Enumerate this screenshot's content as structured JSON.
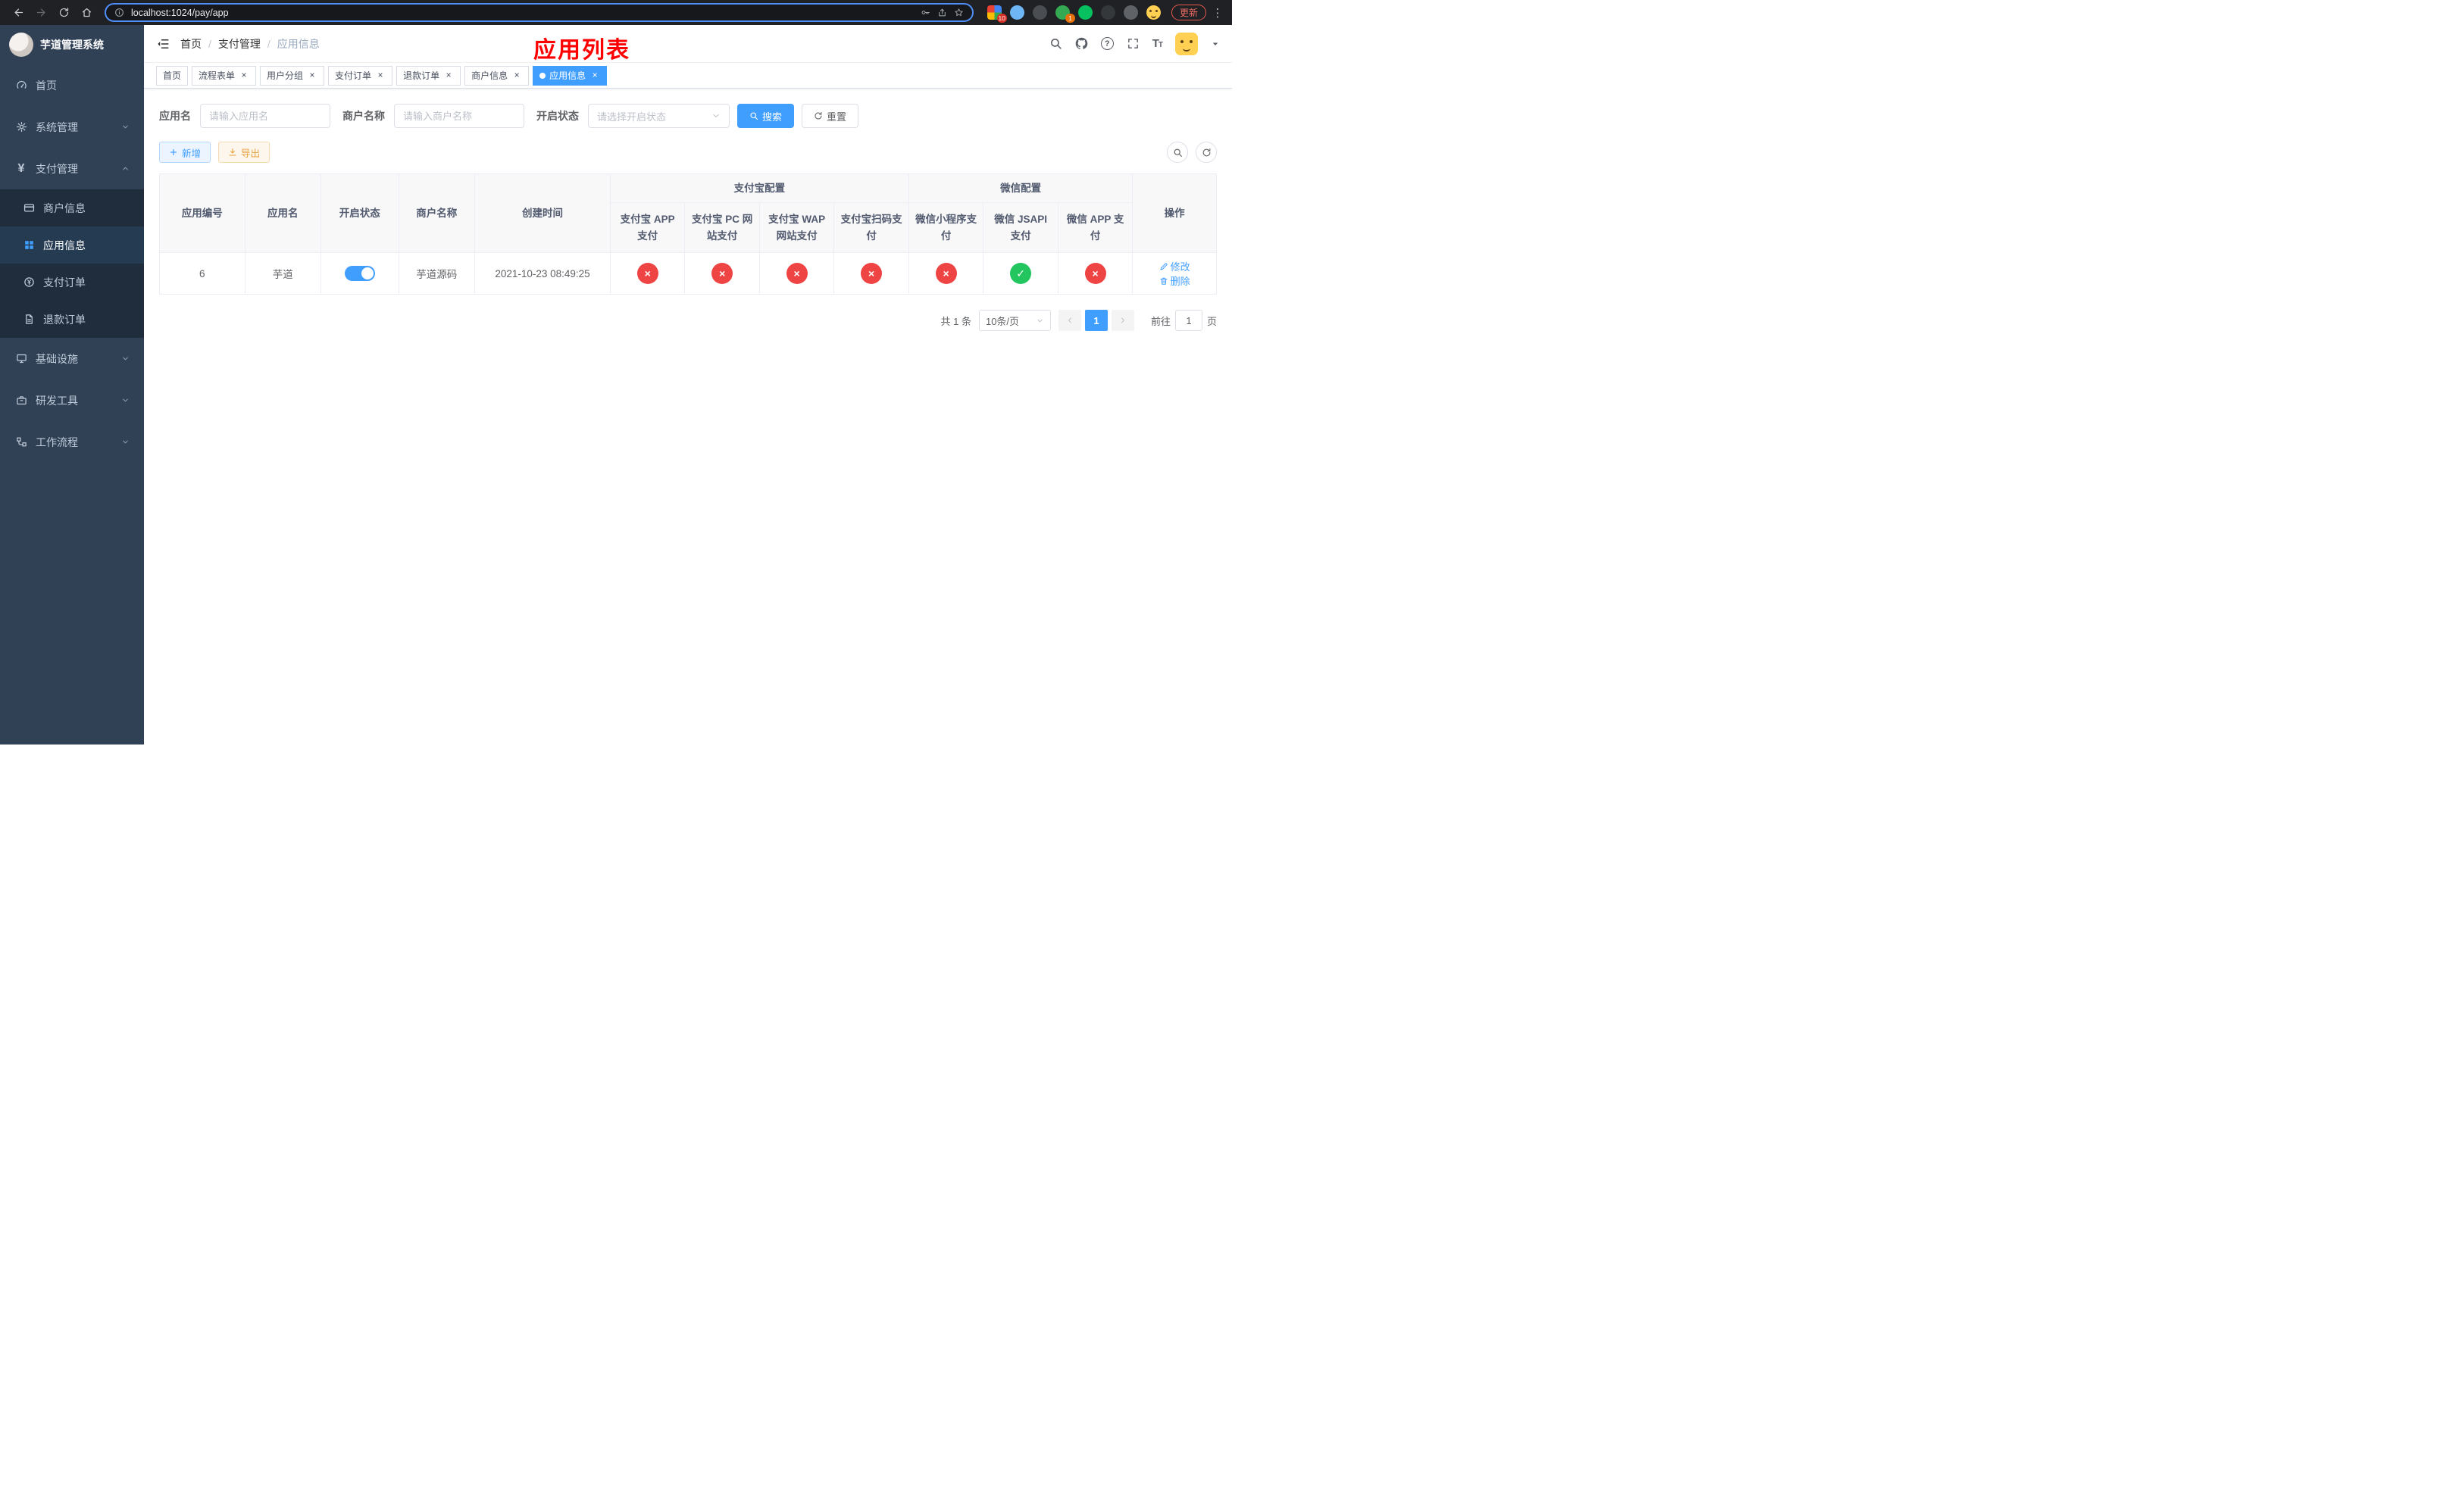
{
  "colors": {
    "accent": "#409eff",
    "success": "#22c55e",
    "danger": "#ef4444",
    "warning": "#e6a23c",
    "sidebar_bg": "#304156",
    "submenu_bg": "#1f2d3d",
    "annotation": "#ff0000"
  },
  "browser": {
    "nav_icons": [
      "back-icon",
      "forward-icon",
      "reload-icon",
      "home-icon"
    ],
    "url": "localhost:1024/pay/app",
    "omnibox_icons": [
      "info-icon",
      "key-icon",
      "share-icon",
      "star-icon"
    ],
    "extensions": [
      {
        "name": "colorful-grid-extension",
        "badge": "10"
      },
      {
        "name": "blue-extension"
      },
      {
        "name": "dark-extension"
      },
      {
        "name": "green-extension",
        "badge": "1"
      },
      {
        "name": "wechat-devtools-extension"
      },
      {
        "name": "dark-extension-2"
      },
      {
        "name": "gray-extension"
      },
      {
        "name": "profile-avatar-face"
      }
    ],
    "update_button": "更新",
    "menu_icon": "kebab-menu-icon"
  },
  "sidebar": {
    "logo_title": "芋道管理系统",
    "menu": [
      {
        "label": "首页",
        "icon": "dashboard-icon"
      },
      {
        "label": "系统管理",
        "icon": "gear-icon",
        "state": "collapsed"
      },
      {
        "label": "支付管理",
        "icon": "yen-icon",
        "state": "expanded",
        "children": [
          {
            "label": "商户信息",
            "icon": "merchant-card-icon"
          },
          {
            "label": "应用信息",
            "icon": "app-grid-icon",
            "active": true
          },
          {
            "label": "支付订单",
            "icon": "pay-order-icon"
          },
          {
            "label": "退款订单",
            "icon": "refund-doc-icon"
          }
        ]
      },
      {
        "label": "基础设施",
        "icon": "infrastructure-icon",
        "state": "collapsed"
      },
      {
        "label": "研发工具",
        "icon": "devtools-icon",
        "state": "collapsed"
      },
      {
        "label": "工作流程",
        "icon": "workflow-icon",
        "state": "collapsed"
      }
    ]
  },
  "header": {
    "breadcrumb": [
      "首页",
      "支付管理",
      "应用信息"
    ],
    "annotation_title": "应用列表",
    "right_icons": [
      "search-icon",
      "github-icon",
      "help-icon",
      "fullscreen-icon",
      "font-size-icon",
      "user-avatar",
      "caret-down-icon"
    ]
  },
  "tabs": [
    {
      "label": "首页",
      "closable": false
    },
    {
      "label": "流程表单",
      "closable": true
    },
    {
      "label": "用户分组",
      "closable": true
    },
    {
      "label": "支付订单",
      "closable": true
    },
    {
      "label": "退款订单",
      "closable": true
    },
    {
      "label": "商户信息",
      "closable": true
    },
    {
      "label": "应用信息",
      "closable": true,
      "active": true
    }
  ],
  "filters": {
    "app_name_label": "应用名",
    "app_name_placeholder": "请输入应用名",
    "merchant_label": "商户名称",
    "merchant_placeholder": "请输入商户名称",
    "status_label": "开启状态",
    "status_placeholder": "请选择开启状态",
    "search_button": "搜索",
    "reset_button": "重置"
  },
  "toolbar": {
    "add_button": "新增",
    "export_button": "导出",
    "icon_buttons": [
      "search-toggle-icon",
      "refresh-icon"
    ]
  },
  "table": {
    "group_headers": {
      "alipay": "支付宝配置",
      "wechat": "微信配置"
    },
    "columns": [
      "应用编号",
      "应用名",
      "开启状态",
      "商户名称",
      "创建时间",
      "支付宝 APP 支付",
      "支付宝 PC 网站支付",
      "支付宝 WAP 网站支付",
      "支付宝扫码支付",
      "微信小程序支付",
      "微信 JSAPI 支付",
      "微信 APP 支付",
      "操作"
    ],
    "rows": [
      {
        "id": "6",
        "name": "芋道",
        "enabled": true,
        "merchant": "芋道源码",
        "created_at": "2021-10-23 08:49:25",
        "statuses": {
          "alipay_app": false,
          "alipay_pc": false,
          "alipay_wap": false,
          "alipay_qr": false,
          "wechat_lite": false,
          "wechat_jsapi": true,
          "wechat_app": false
        },
        "edit_label": "修改",
        "delete_label": "删除"
      }
    ]
  },
  "pagination": {
    "total_text": "共 1 条",
    "page_size": "10条/页",
    "current_page": "1",
    "goto_prefix": "前往",
    "goto_value": "1",
    "goto_suffix": "页"
  }
}
